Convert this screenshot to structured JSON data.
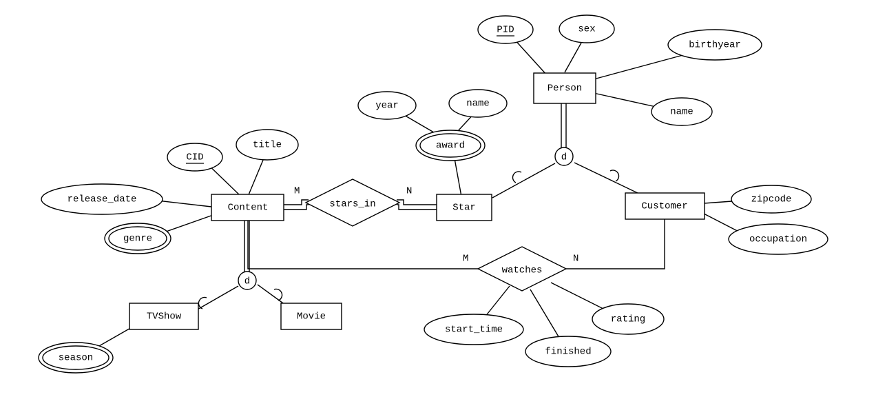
{
  "diagram_type": "ER Diagram",
  "entities": {
    "content": {
      "label": "Content"
    },
    "person": {
      "label": "Person"
    },
    "star": {
      "label": "Star"
    },
    "customer": {
      "label": "Customer"
    },
    "tvshow": {
      "label": "TVShow"
    },
    "movie": {
      "label": "Movie"
    }
  },
  "relationships": {
    "stars_in": {
      "label": "stars_in",
      "left_card": "M",
      "right_card": "N"
    },
    "watches": {
      "label": "watches",
      "left_card": "M",
      "right_card": "N"
    }
  },
  "specializations": {
    "content_d": {
      "label": "d"
    },
    "person_d": {
      "label": "d"
    }
  },
  "attributes": {
    "cid": {
      "label": "CID",
      "key": true,
      "multivalued": false
    },
    "title": {
      "label": "title",
      "key": false,
      "multivalued": false
    },
    "release_date": {
      "label": "release_date",
      "key": false,
      "multivalued": false
    },
    "genre": {
      "label": "genre",
      "key": false,
      "multivalued": true
    },
    "season": {
      "label": "season",
      "key": false,
      "multivalued": true
    },
    "award": {
      "label": "award",
      "key": false,
      "multivalued": true
    },
    "year": {
      "label": "year",
      "key": false,
      "multivalued": false
    },
    "award_name": {
      "label": "name",
      "key": false,
      "multivalued": false
    },
    "pid": {
      "label": "PID",
      "key": true,
      "multivalued": false
    },
    "sex": {
      "label": "sex",
      "key": false,
      "multivalued": false
    },
    "birthyear": {
      "label": "birthyear",
      "key": false,
      "multivalued": false
    },
    "person_name": {
      "label": "name",
      "key": false,
      "multivalued": false
    },
    "zipcode": {
      "label": "zipcode",
      "key": false,
      "multivalued": false
    },
    "occupation": {
      "label": "occupation",
      "key": false,
      "multivalued": false
    },
    "start_time": {
      "label": "start_time",
      "key": false,
      "multivalued": false
    },
    "finished": {
      "label": "finished",
      "key": false,
      "multivalued": false
    },
    "rating": {
      "label": "rating",
      "key": false,
      "multivalued": false
    }
  }
}
